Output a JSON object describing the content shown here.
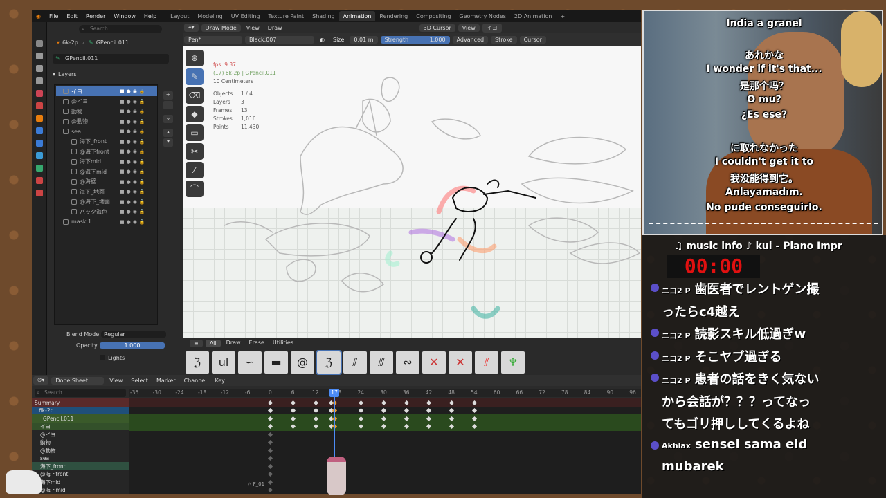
{
  "menu": [
    "File",
    "Edit",
    "Render",
    "Window",
    "Help"
  ],
  "workspaces": [
    "Layout",
    "Modeling",
    "UV Editing",
    "Texture Paint",
    "Shading",
    "Animation",
    "Rendering",
    "Compositing",
    "Geometry Nodes",
    "2D Animation",
    "+"
  ],
  "active_workspace": "Animation",
  "props": {
    "search_placeholder": "Search",
    "breadcrumb_object": "6k-2p",
    "breadcrumb_data": "GPencil.011",
    "datablock": "GPencil.011",
    "layers_title": "Layers",
    "layers": [
      {
        "name": "イヨ",
        "active": true,
        "indent": 0
      },
      {
        "name": "@イヨ",
        "active": false,
        "indent": 0
      },
      {
        "name": "動物",
        "active": false,
        "indent": 0
      },
      {
        "name": "@動物",
        "active": false,
        "indent": 0
      },
      {
        "name": "sea",
        "active": false,
        "indent": 0
      },
      {
        "name": "海下_front",
        "active": false,
        "indent": 1
      },
      {
        "name": "@海下front",
        "active": false,
        "indent": 1
      },
      {
        "name": "海下mid",
        "active": false,
        "indent": 1
      },
      {
        "name": "@海下mid",
        "active": false,
        "indent": 1
      },
      {
        "name": "@海壁",
        "active": false,
        "indent": 1
      },
      {
        "name": "海下_地面",
        "active": false,
        "indent": 1
      },
      {
        "name": "@海下_地面",
        "active": false,
        "indent": 1
      },
      {
        "name": "バック海色",
        "active": false,
        "indent": 1
      },
      {
        "name": "mask 1",
        "active": false,
        "indent": 0
      }
    ],
    "blend_mode_label": "Blend Mode",
    "blend_mode_value": "Regular",
    "opacity_label": "Opacity",
    "opacity_value": "1.000",
    "lights_label": "Lights"
  },
  "viewport": {
    "mode": "Draw Mode",
    "view": "View",
    "draw": "Draw",
    "cursor": "3D Cursor",
    "view2": "View",
    "layer": "イヨ",
    "brush": "Pen*",
    "material": "Black.007",
    "size_label": "Size",
    "size_value": "0.01 m",
    "strength_label": "Strength",
    "strength_value": "1.000",
    "advanced": "Advanced",
    "stroke": "Stroke",
    "cursor_menu": "Cursor",
    "fps": "fps: 9.37",
    "frame_info": "(17) 6k-2p | GPencil.011",
    "units": "10 Centimeters",
    "stats_labels": [
      "Objects",
      "Layers",
      "Frames",
      "Strokes",
      "Points"
    ],
    "stats_values": [
      "1 / 4",
      "3",
      "13",
      "1,016",
      "11,430"
    ],
    "brush_tabs": [
      "All",
      "Draw",
      "Erase",
      "Utilities"
    ]
  },
  "dopesheet": {
    "editor": "Dope Sheet",
    "menus": [
      "View",
      "Select",
      "Marker",
      "Channel",
      "Key"
    ],
    "search_placeholder": "Search",
    "ticks": [
      "-36",
      "-30",
      "-24",
      "-18",
      "-12",
      "-6",
      "0",
      "6",
      "12",
      "18",
      "24",
      "30",
      "36",
      "42",
      "48",
      "54",
      "60",
      "66",
      "72",
      "78",
      "84",
      "90",
      "96"
    ],
    "current_frame": "17",
    "marker": "F_01",
    "channels": [
      "Summary",
      "6k-2p",
      "GPencil.011",
      "イヨ",
      "@イヨ",
      "動物",
      "@動物",
      "sea",
      "海下_front",
      "@海下front",
      "海下mid",
      "@海下mid"
    ]
  },
  "webcam": {
    "title": "India a granel",
    "lines1": [
      "あれかな",
      "I wonder if it's that...",
      "是那个吗？",
      "O mu?",
      "¿Es ese?"
    ],
    "lines2": [
      "に取れなかった",
      "I couldn't get it to",
      "我没能得到它。",
      "Anlayamadım.",
      "No pude conseguirlo."
    ]
  },
  "chat": {
    "music": "♫ music info ♪  kui - Piano Impr",
    "timer": "00:00",
    "messages": [
      {
        "nick": "ニコ2 P",
        "text": "歯医者でレントゲン撮"
      },
      {
        "nick": "",
        "text": "ったらc4越え"
      },
      {
        "nick": "ニコ2 P",
        "text": "読影スキル低過ぎw"
      },
      {
        "nick": "ニコ2 P",
        "text": "そこヤブ過ぎる"
      },
      {
        "nick": "ニコ2 P",
        "text": "患者の話をきく気ない"
      },
      {
        "nick": "",
        "text": "から会話が？？？ってなっ"
      },
      {
        "nick": "",
        "text": "てもゴリ押ししてくるよね"
      },
      {
        "nick": "Akhlax",
        "text": "sensei sama eid"
      },
      {
        "nick": "",
        "text": "mubarek"
      }
    ]
  }
}
